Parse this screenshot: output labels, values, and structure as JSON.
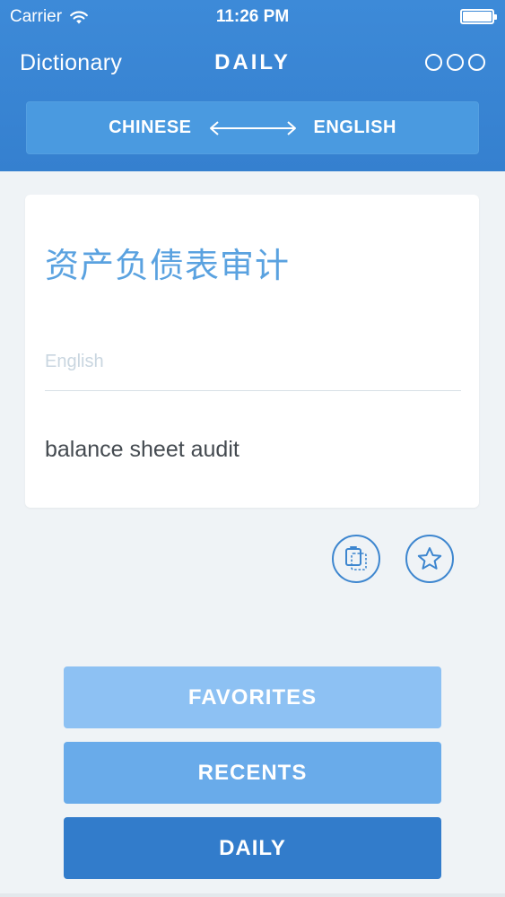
{
  "status_bar": {
    "carrier": "Carrier",
    "time": "11:26 PM",
    "wifi_icon": "wifi-icon",
    "battery_icon": "battery-icon"
  },
  "nav": {
    "back_label": "Dictionary",
    "title": "DAILY",
    "more_icon": "more-icon"
  },
  "language_switch": {
    "source": "CHINESE",
    "target": "ENGLISH",
    "swap_icon": "swap-arrows-icon"
  },
  "card": {
    "source_text": "资产负债表审计",
    "target_language_label": "English",
    "translation": "balance sheet audit"
  },
  "actions": {
    "copy_icon": "copy-icon",
    "favorite_icon": "star-icon"
  },
  "buttons": {
    "favorites": "FAVORITES",
    "recents": "RECENTS",
    "daily": "DAILY"
  },
  "colors": {
    "header": "#3580cf",
    "accent": "#5aa2e0",
    "favorites_btn": "#8dc1f3",
    "recents_btn": "#69abea",
    "daily_btn": "#327ccb"
  }
}
